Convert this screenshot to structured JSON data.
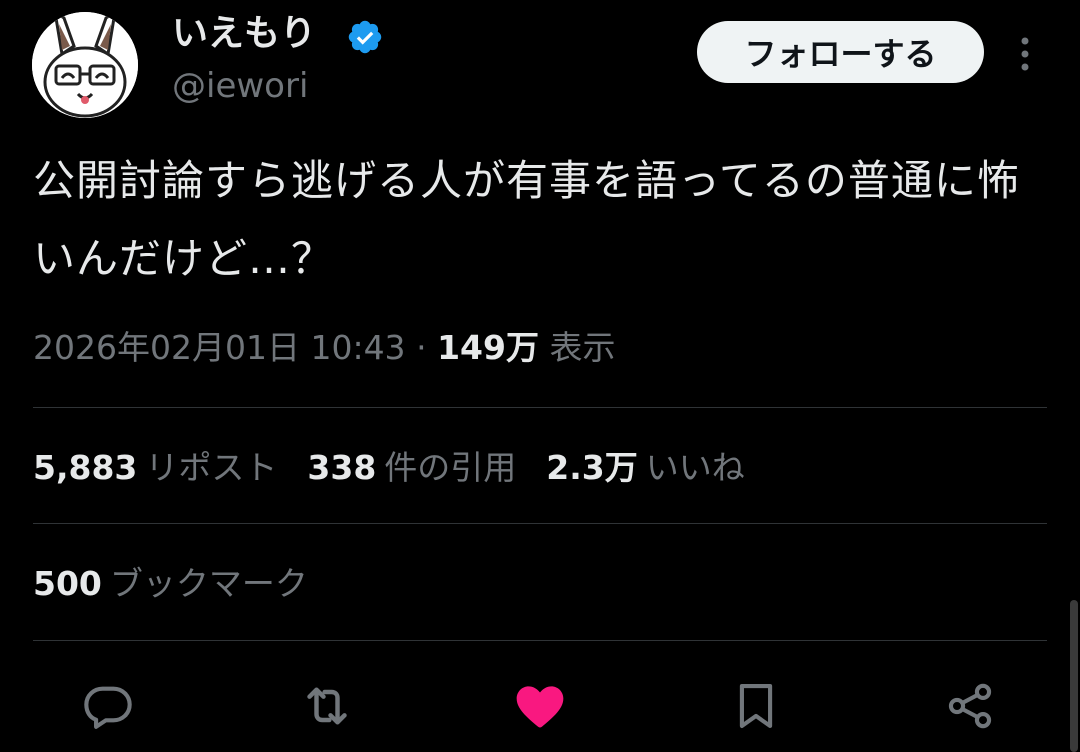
{
  "author": {
    "display_name": "いえもり",
    "handle": "@iewori",
    "verified": true
  },
  "header": {
    "follow_label": "フォローする"
  },
  "tweet": {
    "text": "公開討論すら逃げる人が有事を語ってるの普通に怖いんだけど…？",
    "timestamp": "2026年02月01日 10:43",
    "separator": "·",
    "views_count": "149万",
    "views_label": "表示"
  },
  "stats": {
    "reposts_count": "5,883",
    "reposts_label": "リポスト",
    "quotes_count": "338",
    "quotes_label": "件の引用",
    "likes_count": "2.3万",
    "likes_label": "いいね",
    "bookmarks_count": "500",
    "bookmarks_label": "ブックマーク"
  },
  "actions": [
    {
      "name": "reply-icon"
    },
    {
      "name": "repost-icon"
    },
    {
      "name": "like-icon",
      "active": true
    },
    {
      "name": "bookmark-icon"
    },
    {
      "name": "share-icon"
    }
  ],
  "colors": {
    "background": "#000000",
    "primary_text": "#e7e9ea",
    "secondary_text": "#71767b",
    "divider": "#2f3336",
    "verified_blue": "#1d9bf0",
    "like_pink": "#f91880",
    "follow_bg": "#eff3f4"
  }
}
